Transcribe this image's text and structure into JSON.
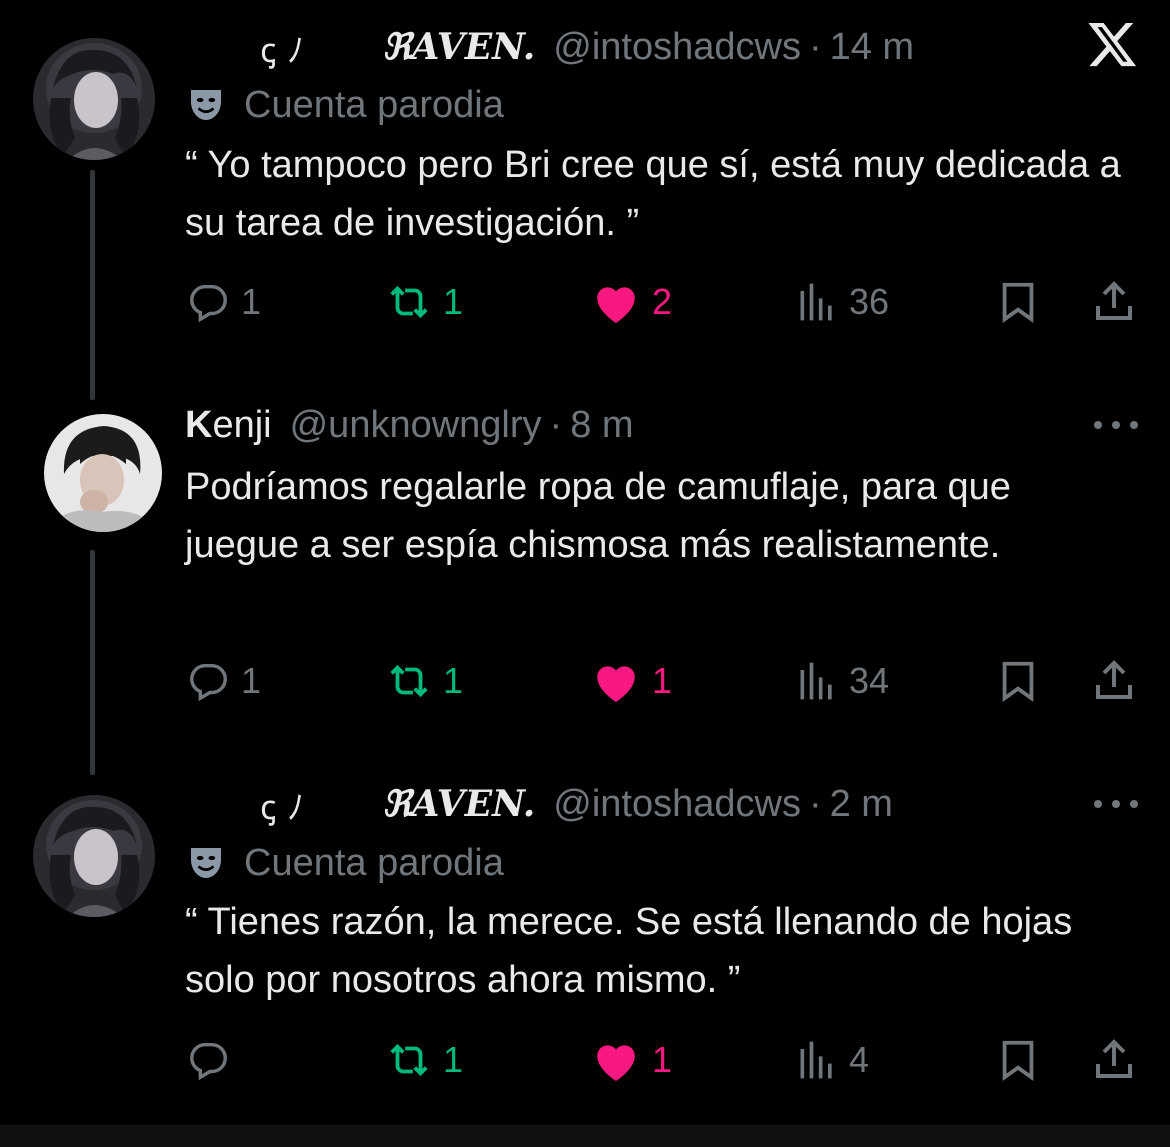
{
  "app": {
    "logo": "x-logo"
  },
  "tweets": [
    {
      "decoration": "ꞔ ﾉ",
      "name": "ℜAVEN.",
      "handle": "@intoshadcws",
      "separator": "·",
      "time": "14 m",
      "label": "Cuenta parodia",
      "text": "“ Yo tampoco pero Bri cree que sí, está muy dedicada a su tarea de investigación. ”",
      "replies": "1",
      "reposts": "1",
      "likes": "2",
      "views": "36"
    },
    {
      "name_bold": "K",
      "name_rest": "enji",
      "handle": "@unknownglry",
      "separator": "·",
      "time": "8 m",
      "text": "Podríamos regalarle ropa de camuflaje, para que juegue a ser espía chismosa más realistamente.",
      "replies": "1",
      "reposts": "1",
      "likes": "1",
      "views": "34"
    },
    {
      "decoration": "ꞔ ﾉ",
      "name": "ℜAVEN.",
      "handle": "@intoshadcws",
      "separator": "·",
      "time": "2 m",
      "label": "Cuenta parodia",
      "text": "“ Tienes razón, la merece. Se está llenando de hojas solo por nosotros ahora mismo. ”",
      "replies": "",
      "reposts": "1",
      "likes": "1",
      "views": "4"
    }
  ],
  "colors": {
    "background": "#000000",
    "text": "#e7e9ea",
    "muted": "#71767b",
    "repost": "#00ba7c",
    "like": "#f91880"
  }
}
